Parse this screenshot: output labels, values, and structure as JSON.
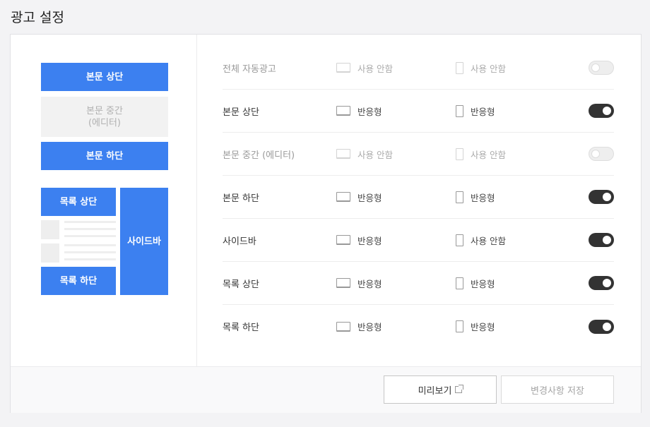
{
  "header": {
    "title": "광고 설정"
  },
  "layout_preview": {
    "top": "본문 상단",
    "middle": "본문 중간\n(에디터)",
    "bottom": "본문 하단",
    "list_top": "목록 상단",
    "list_bottom": "목록 하단",
    "sidebar": "사이드바"
  },
  "settings": {
    "rows": [
      {
        "label": "전체 자동광고",
        "pc": "사용 안함",
        "mobile": "사용 안함",
        "enabled": false
      },
      {
        "label": "본문 상단",
        "pc": "반응형",
        "mobile": "반응형",
        "enabled": true
      },
      {
        "label": "본문 중간 (에디터)",
        "pc": "사용 안함",
        "mobile": "사용 안함",
        "enabled": false
      },
      {
        "label": "본문 하단",
        "pc": "반응형",
        "mobile": "반응형",
        "enabled": true
      },
      {
        "label": "사이드바",
        "pc": "반응형",
        "mobile": "사용 안함",
        "enabled": true
      },
      {
        "label": "목록 상단",
        "pc": "반응형",
        "mobile": "반응형",
        "enabled": true
      },
      {
        "label": "목록 하단",
        "pc": "반응형",
        "mobile": "반응형",
        "enabled": true
      }
    ]
  },
  "footer": {
    "preview_label": "미리보기",
    "save_label": "변경사항 저장"
  },
  "colors": {
    "accent": "#3c80f0",
    "toggle_on": "#333333",
    "toggle_off": "#eeeeee"
  }
}
